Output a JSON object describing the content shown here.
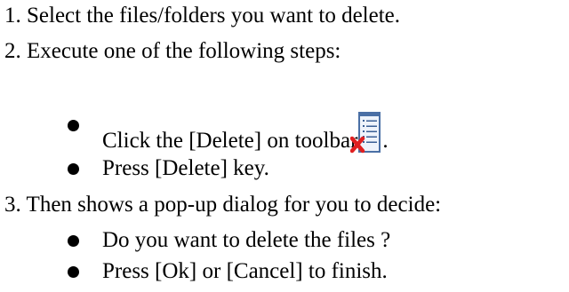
{
  "steps": {
    "step1": "1. Select the files/folders you want to delete.",
    "step2": "2. Execute one of the following steps:",
    "step3": "3. Then shows a pop-up dialog for you to decide:"
  },
  "step2_bullets": {
    "click_text": "Click the [Delete] on toolbar",
    "click_suffix": ".",
    "press_text": "Press [Delete] key."
  },
  "step3_bullets": {
    "confirm_question": "Do you want to delete the files ?",
    "finish_text": "Press [Ok] or [Cancel] to finish."
  },
  "icons": {
    "toolbar_delete": "delete-list-icon"
  },
  "colors": {
    "text": "#000000",
    "icon_frame": "#4a6fa5",
    "icon_x": "#e02020"
  }
}
